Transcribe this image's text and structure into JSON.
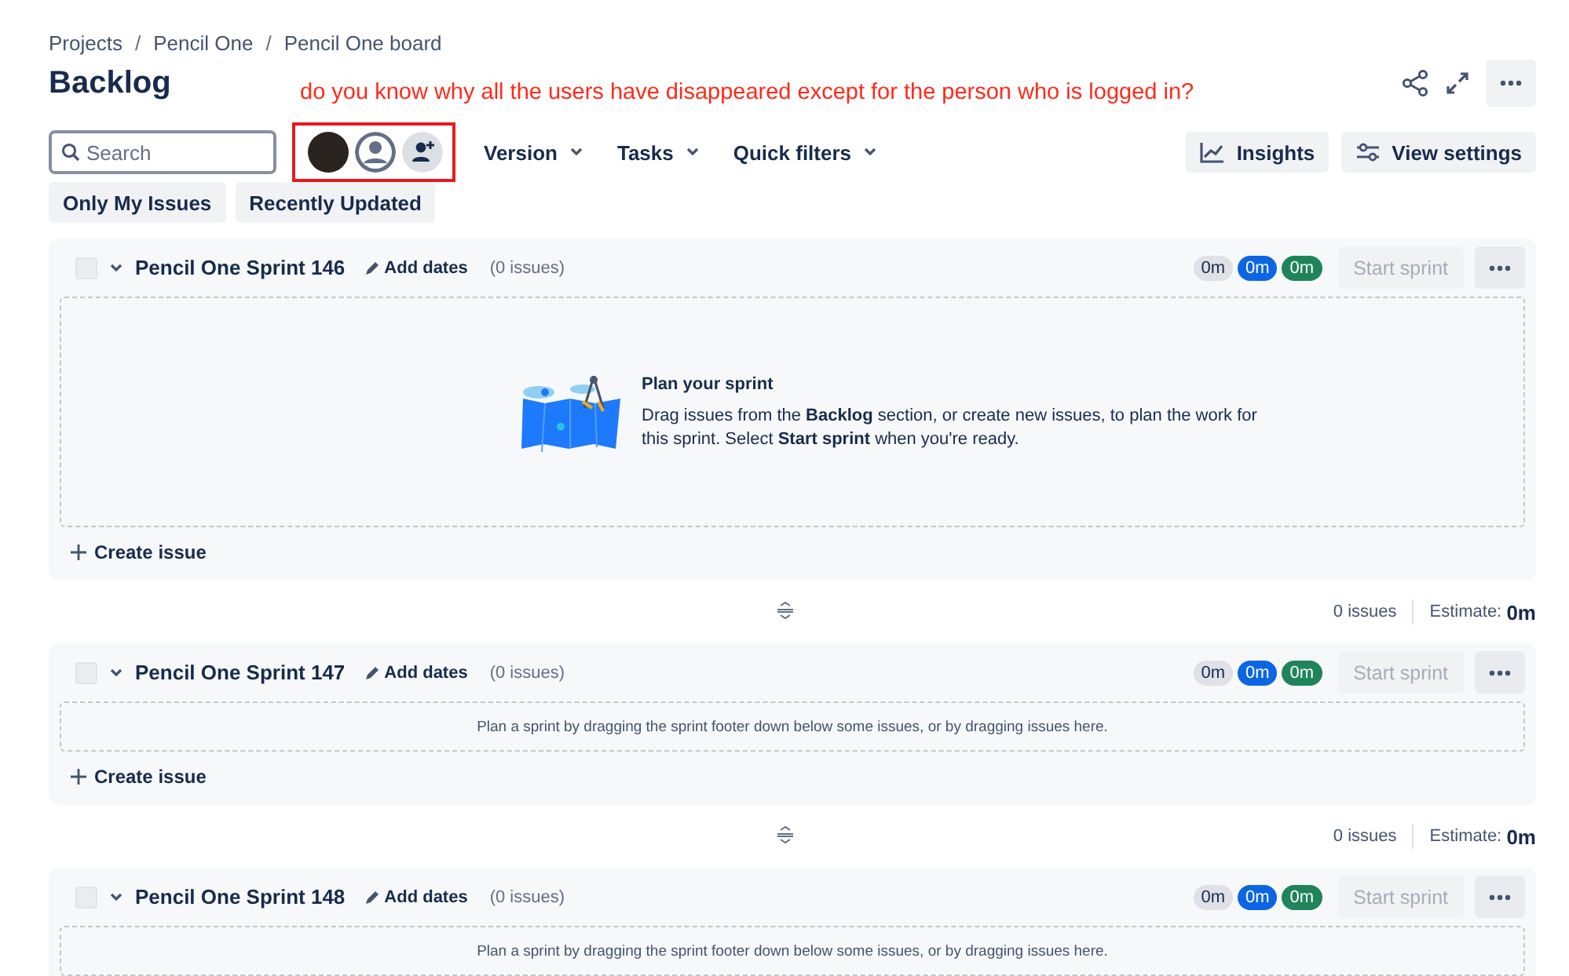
{
  "breadcrumbs": [
    {
      "text": "Projects"
    },
    {
      "separator": "/",
      "text": "Pencil One"
    },
    {
      "separator": "/",
      "text": "Pencil One board"
    }
  ],
  "title": "Backlog",
  "annotation": "do you know why all the users have disappeared except for the person who is logged in?",
  "search": {
    "placeholder": "Search"
  },
  "filters": [
    {
      "label": "Version"
    },
    {
      "label": "Tasks"
    },
    {
      "label": "Quick filters"
    }
  ],
  "actions": [
    {
      "kind": "insights",
      "label": "Insights"
    },
    {
      "kind": "settings",
      "label": "View settings"
    }
  ],
  "quick_filters": [
    {
      "label": "Only My Issues",
      "selected": false
    },
    {
      "label": "Recently Updated",
      "selected": false
    }
  ],
  "sprints": [
    {
      "name": "Pencil One Sprint 146",
      "checked": false,
      "expanded": true,
      "add_dates": "Add dates",
      "issue_count": "(0 issues)",
      "badges": [
        {
          "text": "0m",
          "color": "#dfe1e6"
        },
        {
          "text": "0m",
          "color": "#0c66e4"
        },
        {
          "text": "0m",
          "color": "#1f845a"
        }
      ],
      "start": {
        "label": "Start sprint",
        "disabled": true
      },
      "empty": {
        "kind": "illustrated",
        "title": "Plan your sprint",
        "body": "Drag issues from the **Backlog** section, or create new issues, to plan the work for this sprint. Select **Start sprint** when you're ready."
      },
      "create": "Create issue",
      "footer": {
        "issues": "0 issues",
        "estimate_label": "Estimate:",
        "estimate": "0m"
      }
    },
    {
      "name": "Pencil One Sprint 147",
      "checked": false,
      "expanded": true,
      "add_dates": "Add dates",
      "issue_count": "(0 issues)",
      "badges": [
        {
          "text": "0m",
          "color": "#dfe1e6"
        },
        {
          "text": "0m",
          "color": "#0c66e4"
        },
        {
          "text": "0m",
          "color": "#1f845a"
        }
      ],
      "start": {
        "label": "Start sprint",
        "disabled": true
      },
      "empty": {
        "kind": "plain",
        "body": "Plan a sprint by dragging the sprint footer down below some issues, or by dragging issues here."
      },
      "create": "Create issue",
      "footer": {
        "issues": "0 issues",
        "estimate_label": "Estimate:",
        "estimate": "0m"
      }
    },
    {
      "name": "Pencil One Sprint 148",
      "checked": false,
      "expanded": true,
      "add_dates": "Add dates",
      "issue_count": "(0 issues)",
      "badges": [
        {
          "text": "0m",
          "color": "#dfe1e6"
        },
        {
          "text": "0m",
          "color": "#0c66e4"
        },
        {
          "text": "0m",
          "color": "#1f845a"
        }
      ],
      "start": {
        "label": "Start sprint",
        "disabled": true
      },
      "empty": {
        "kind": "plain",
        "body": "Plan a sprint by dragging the sprint footer down below some issues, or by dragging issues here."
      }
    }
  ]
}
